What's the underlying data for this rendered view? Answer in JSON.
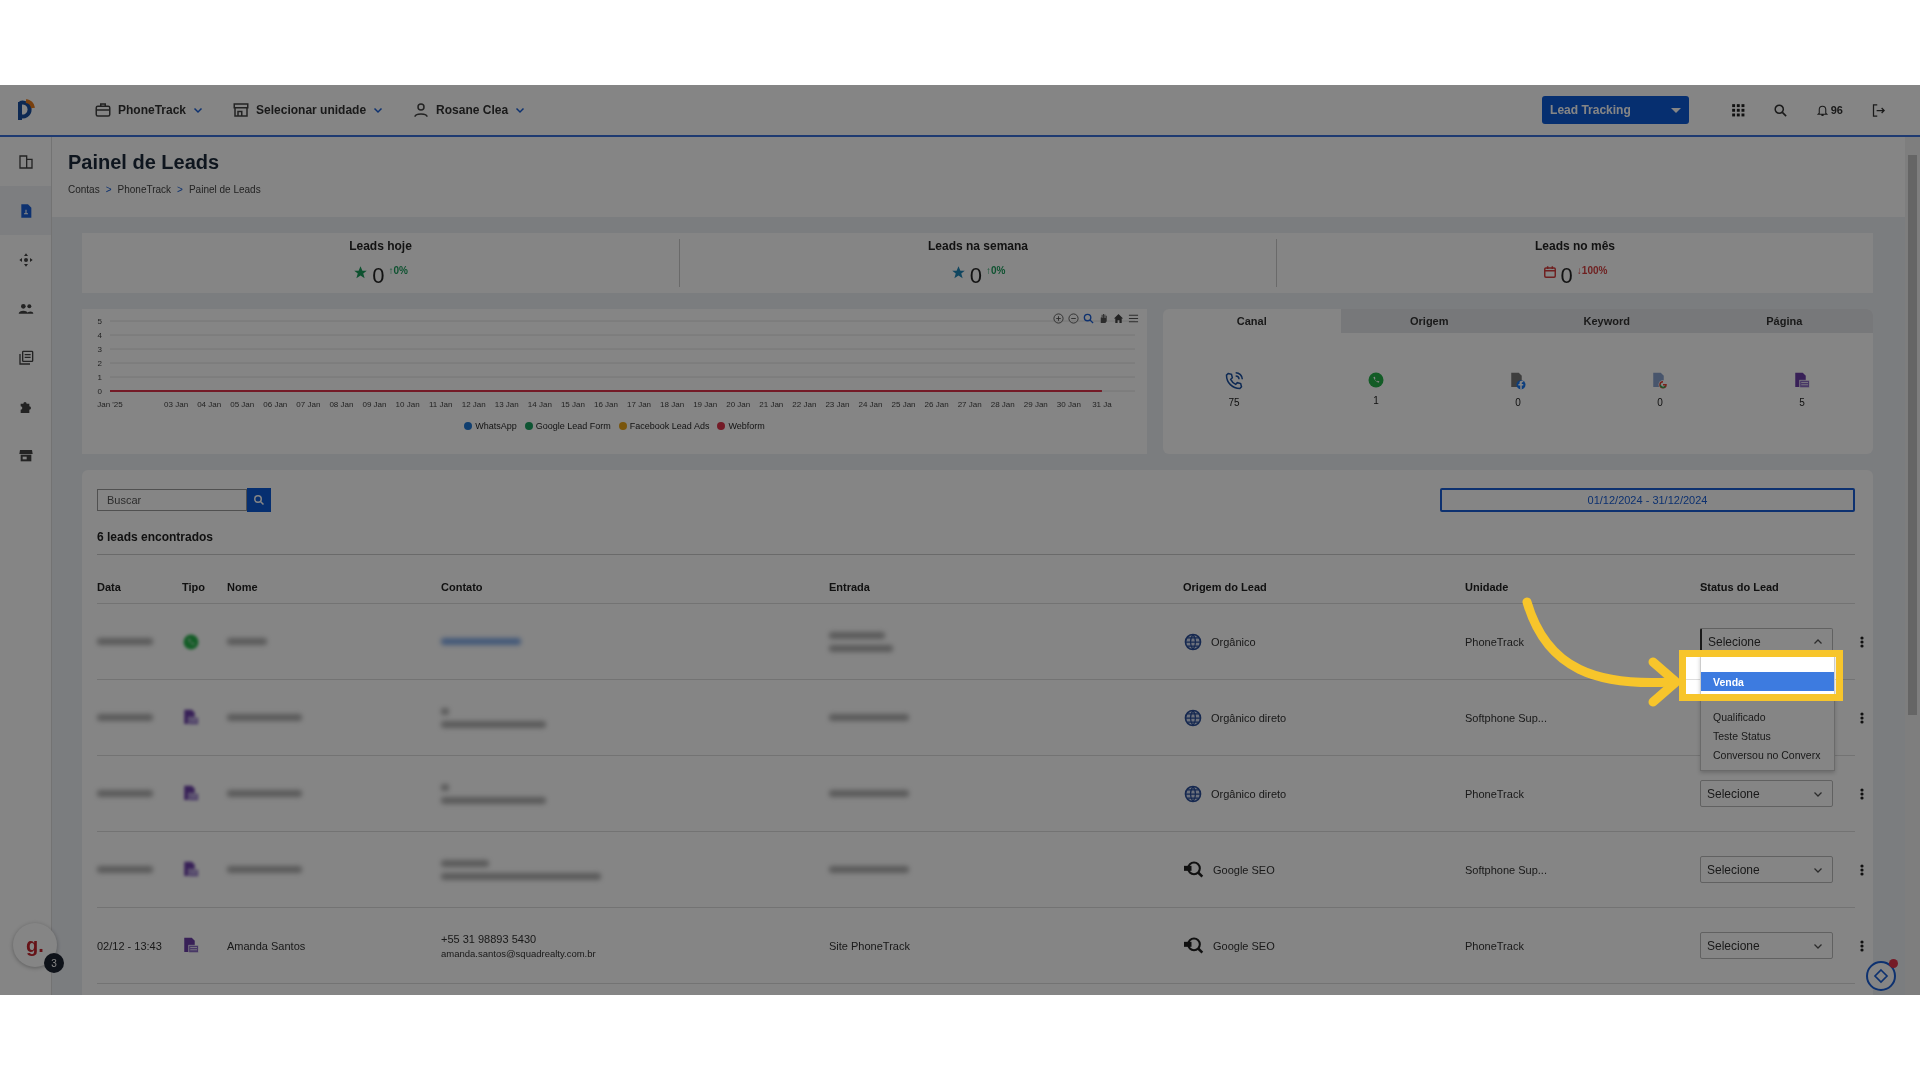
{
  "header": {
    "menus": [
      {
        "label": "PhoneTrack",
        "kind": "briefcase"
      },
      {
        "label": "Selecionar unidade",
        "kind": "store"
      },
      {
        "label": "Rosane Clea",
        "kind": "user"
      }
    ],
    "product_button": "Lead Tracking",
    "notifications": "96"
  },
  "sidebar": {
    "items": [
      {
        "kind": "building",
        "selected": false
      },
      {
        "kind": "document",
        "selected": true
      },
      {
        "kind": "move",
        "selected": false
      },
      {
        "kind": "people",
        "selected": false
      },
      {
        "kind": "library",
        "selected": false
      },
      {
        "kind": "puzzle",
        "selected": false
      },
      {
        "kind": "store",
        "selected": false
      }
    ]
  },
  "page": {
    "title": "Painel de Leads",
    "breadcrumb": [
      "Contas",
      "PhoneTrack",
      "Painel de Leads"
    ],
    "separator": ">"
  },
  "stats": [
    {
      "label": "Leads hoje",
      "value": "0",
      "change": {
        "text": "↑0%",
        "color": "#0e5230"
      },
      "kind": "star",
      "color": "#0e5230"
    },
    {
      "label": "Leads na semana",
      "value": "0",
      "change": {
        "text": "↑0%",
        "color": "#0e5230"
      },
      "kind": "star",
      "color": "#104660"
    },
    {
      "label": "Leads no mês",
      "value": "0",
      "change": {
        "text": "↓100%",
        "color": "#6f1f1f"
      },
      "kind": "calendar",
      "color": "#6f1f1f"
    }
  ],
  "chart": {
    "chart_data": {
      "type": "line",
      "grid": true,
      "categories": [
        "Jan '25",
        "03 Jan",
        "04 Jan",
        "05 Jan",
        "06 Jan",
        "07 Jan",
        "08 Jan",
        "09 Jan",
        "10 Jan",
        "11 Jan",
        "12 Jan",
        "13 Jan",
        "14 Jan",
        "15 Jan",
        "16 Jan",
        "17 Jan",
        "18 Jan",
        "19 Jan",
        "20 Jan",
        "21 Jan",
        "22 Jan",
        "23 Jan",
        "24 Jan",
        "25 Jan",
        "26 Jan",
        "27 Jan",
        "28 Jan",
        "29 Jan",
        "30 Jan",
        "31 Ja"
      ],
      "ylim": [
        0,
        5
      ],
      "yticks": [
        0,
        1,
        2,
        3,
        4,
        5
      ],
      "series": [
        {
          "name": "WhatsApp",
          "color": "#103e6f",
          "values": [
            null,
            null,
            null,
            null,
            null,
            null,
            null,
            null,
            null,
            null,
            null,
            null,
            null,
            null,
            null,
            null,
            null,
            null,
            null,
            null,
            null,
            null,
            null,
            null,
            null,
            null,
            null,
            null,
            null,
            null
          ]
        },
        {
          "name": "Google Lead Form",
          "color": "#0e5432",
          "values": [
            null,
            null,
            null,
            null,
            null,
            null,
            null,
            null,
            null,
            null,
            null,
            null,
            null,
            null,
            null,
            null,
            null,
            null,
            null,
            null,
            null,
            null,
            null,
            null,
            null,
            null,
            null,
            null,
            null,
            null
          ]
        },
        {
          "name": "Facebook Lead Ads",
          "color": "#79550c",
          "values": [
            null,
            null,
            null,
            null,
            null,
            null,
            null,
            null,
            null,
            null,
            null,
            null,
            null,
            null,
            null,
            null,
            null,
            null,
            null,
            null,
            null,
            null,
            null,
            null,
            null,
            null,
            null,
            null,
            null,
            null
          ]
        },
        {
          "name": "Webform",
          "color": "#741b27",
          "values": [
            0,
            0,
            0,
            0,
            0,
            0,
            0,
            0,
            0,
            0,
            0,
            0,
            0,
            0,
            0,
            0,
            0,
            0,
            0,
            0,
            0,
            0,
            0,
            0,
            0,
            0,
            0,
            0,
            0,
            0
          ]
        }
      ]
    }
  },
  "channels": {
    "tabs": [
      {
        "label": "Canal",
        "selected": true
      },
      {
        "label": "Origem",
        "selected": false
      },
      {
        "label": "Keyword",
        "selected": false
      },
      {
        "label": "Página",
        "selected": false
      }
    ],
    "items": [
      {
        "kind": "phone",
        "count": "75"
      },
      {
        "kind": "whatsapp",
        "count": "1"
      },
      {
        "kind": "facebook",
        "count": "0"
      },
      {
        "kind": "google",
        "count": "0"
      },
      {
        "kind": "webform",
        "count": "5"
      }
    ]
  },
  "leads": {
    "search": {
      "placeholder": "Buscar"
    },
    "date_range": "01/12/2024 - 31/12/2024",
    "count_text": "6 leads encontrados",
    "columns": [
      "Data",
      "Tipo",
      "Nome",
      "Contato",
      "Entrada",
      "Origem do Lead",
      "Unidade",
      "Status do Lead"
    ],
    "rows": [
      {
        "blurred": true,
        "kind": "whatsapp",
        "origin": {
          "label": "Orgânico",
          "kind": "globe"
        },
        "unit": "PhoneTrack",
        "status": {
          "value": "Selecione",
          "expanded": true
        }
      },
      {
        "blurred": true,
        "kind": "webform",
        "origin": {
          "label": "Orgânico direto",
          "kind": "globe"
        },
        "unit": "Softphone Sup..."
      },
      {
        "blurred": true,
        "kind": "webform",
        "origin": {
          "label": "Orgânico direto",
          "kind": "globe"
        },
        "unit": "PhoneTrack",
        "status": {
          "value": "Selecione",
          "expanded": false
        }
      },
      {
        "blurred": true,
        "kind": "webform",
        "origin": {
          "label": "Google SEO",
          "kind": "seo"
        },
        "unit": "Softphone Sup...",
        "status": {
          "value": "Selecione",
          "expanded": false
        }
      },
      {
        "blurred": false,
        "kind": "webform",
        "date": "02/12 - 13:43",
        "name": "Amanda Santos",
        "phone": "+55 31 98893 5430",
        "email": "amanda.santos@squadrealty.com.br",
        "entry": "Site PhoneTrack",
        "origin": {
          "label": "Google SEO",
          "kind": "seo"
        },
        "unit": "PhoneTrack",
        "status": {
          "value": "Selecione",
          "expanded": false
        }
      }
    ],
    "status_dropdown": {
      "options": [
        {
          "label": "Venda",
          "selected": true
        },
        {
          "label": "Qualificado",
          "selected": false
        },
        {
          "label": "Teste Status",
          "selected": false
        },
        {
          "label": "Conversou no Converx",
          "selected": false
        }
      ]
    }
  },
  "chat_avatar": {
    "letter": "g.",
    "badge": "3"
  }
}
